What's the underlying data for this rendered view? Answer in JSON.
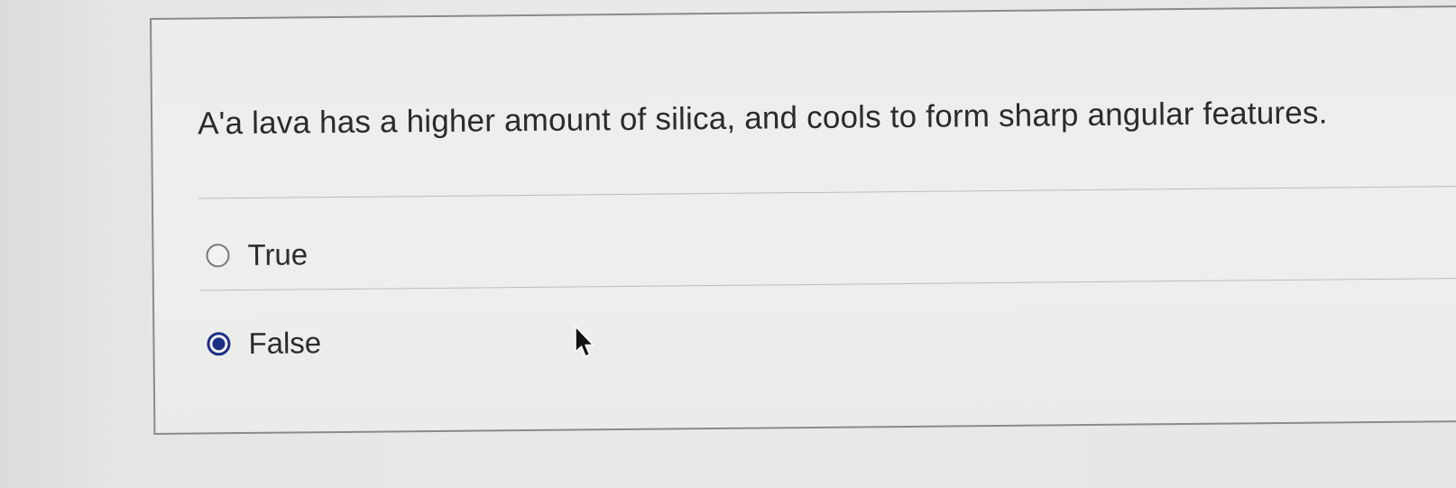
{
  "question": {
    "text": "A'a lava has a higher amount of silica, and cools to form sharp angular features."
  },
  "options": [
    {
      "label": "True",
      "selected": false
    },
    {
      "label": "False",
      "selected": true
    }
  ],
  "colors": {
    "selected_radio": "#1b2f86",
    "text": "#2b2b2b"
  },
  "icons": {
    "cursor": "mouse-pointer-icon"
  }
}
